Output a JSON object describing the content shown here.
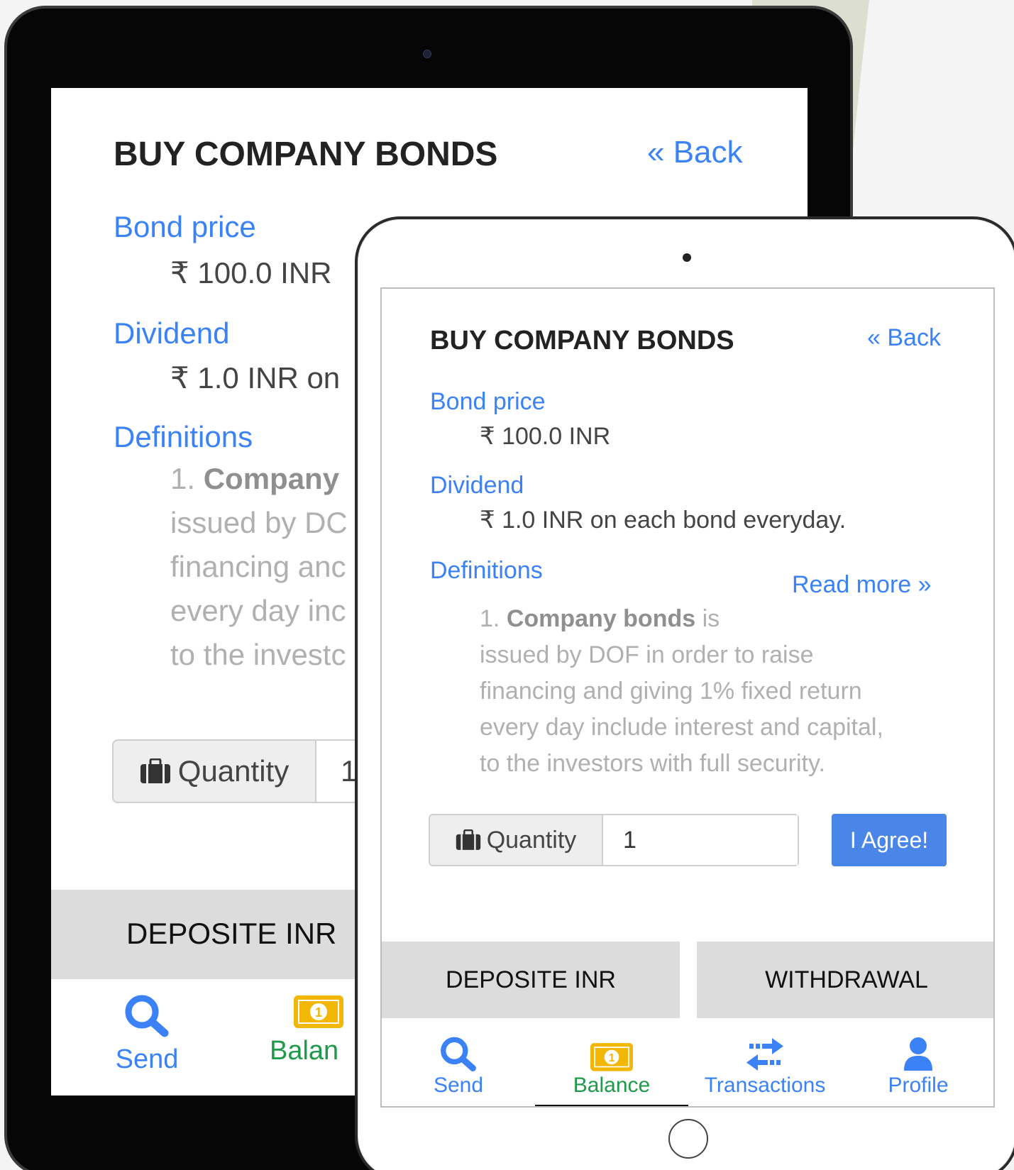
{
  "title": "BUY COMPANY BONDS",
  "back_label": "« Back",
  "bond_price": {
    "label": "Bond price",
    "value": "₹ 100.0 INR"
  },
  "dividend": {
    "label": "Dividend",
    "value": "₹ 1.0 INR on each bond everyday.",
    "value_cropped": "₹ 1.0 INR on"
  },
  "definitions": {
    "label": "Definitions",
    "read_more": "Read more »",
    "number": "1.",
    "term": "Company bonds",
    "term_cropped": "Company",
    "is": "is",
    "lines": [
      "issued by DOF in order to raise",
      "financing and giving 1% fixed return",
      "every day include interest and capital,",
      "to the investors with full security."
    ],
    "lines_cropped": [
      "issued by DC",
      "financing anc",
      "every day inc",
      "to the investc"
    ]
  },
  "quantity": {
    "label": "Quantity",
    "value": "1"
  },
  "agree_label": "I Agree!",
  "actions": {
    "deposit": "DEPOSITE INR",
    "withdrawal": "WITHDRAWAL"
  },
  "nav": {
    "send": "Send",
    "balance": "Balance",
    "balance_cropped": "Balan",
    "transactions": "Transactions",
    "profile": "Profile",
    "active": "Balance"
  },
  "colors": {
    "accent": "#3b82f6",
    "button": "#4a86e8",
    "active_tab": "#1f9a4a",
    "money_icon": "#f2b705",
    "arrow": "#d9dccb"
  }
}
